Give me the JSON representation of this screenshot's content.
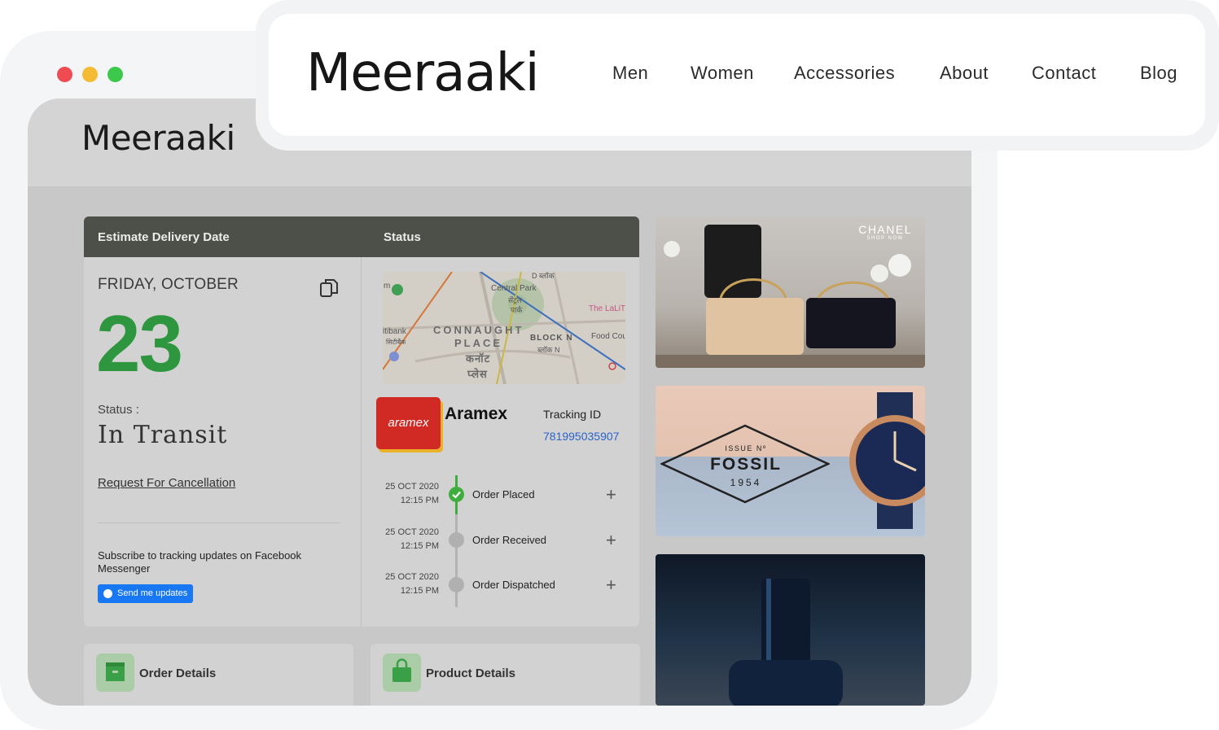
{
  "brand": {
    "logo": "Meeraaki"
  },
  "nav": {
    "items": [
      {
        "label": "Men"
      },
      {
        "label": "Women"
      },
      {
        "label": "Accessories"
      },
      {
        "label": "About"
      },
      {
        "label": "Contact"
      },
      {
        "label": "Blog"
      }
    ]
  },
  "window": {
    "logo": "Meeraaki"
  },
  "delivery": {
    "header_left": "Estimate Delivery Date",
    "header_right": "Status",
    "date_label": "FRIDAY, OCTOBER",
    "day": "23",
    "status_label": "Status :",
    "status_value": "In Transit",
    "cancel_link": "Request For Cancellation",
    "subscribe_text": "Subscribe to tracking updates on Facebook Messenger",
    "send_button": "Send me updates"
  },
  "map": {
    "labels": [
      "Central Park",
      "सेंट्रल",
      "पार्क",
      "CONNAUGHT",
      "PLACE",
      "कनॉट",
      "प्लेस",
      "BLOCK N",
      "ब्लॉक N",
      "The LaLiT",
      "Food Cou",
      "itibank",
      "सिटीबैंक",
      "D ब्लॉक",
      "m"
    ]
  },
  "courier": {
    "logo_text": "aramex",
    "name": "Aramex",
    "tracking_label": "Tracking ID",
    "tracking_id": "781995035907"
  },
  "timeline": [
    {
      "date": "25 OCT 2020",
      "time": "12:15 PM",
      "label": "Order Placed",
      "done": true
    },
    {
      "date": "25 OCT 2020",
      "time": "12:15 PM",
      "label": "Order Received",
      "done": false
    },
    {
      "date": "25 OCT 2020",
      "time": "12:15 PM",
      "label": "Order Dispatched",
      "done": false
    }
  ],
  "cards": {
    "order_details": "Order Details",
    "product_details": "Product Details"
  },
  "banners": {
    "chanel": {
      "title": "CHANEL",
      "subtitle": "SHOP NOW"
    },
    "fossil": {
      "issue": "ISSUE Nº",
      "brand": "FOSSIL",
      "year": "1954"
    }
  },
  "icons": [
    "copy-icon",
    "messenger-icon",
    "check-icon",
    "plus-icon",
    "box-icon",
    "bag-icon",
    "map-pin-icon"
  ],
  "colors": {
    "accent_green": "#2f9640",
    "header_dark": "#4c5048",
    "link_blue": "#2a63c9",
    "messenger_blue": "#1877f2",
    "aramex_red": "#d12a24"
  }
}
